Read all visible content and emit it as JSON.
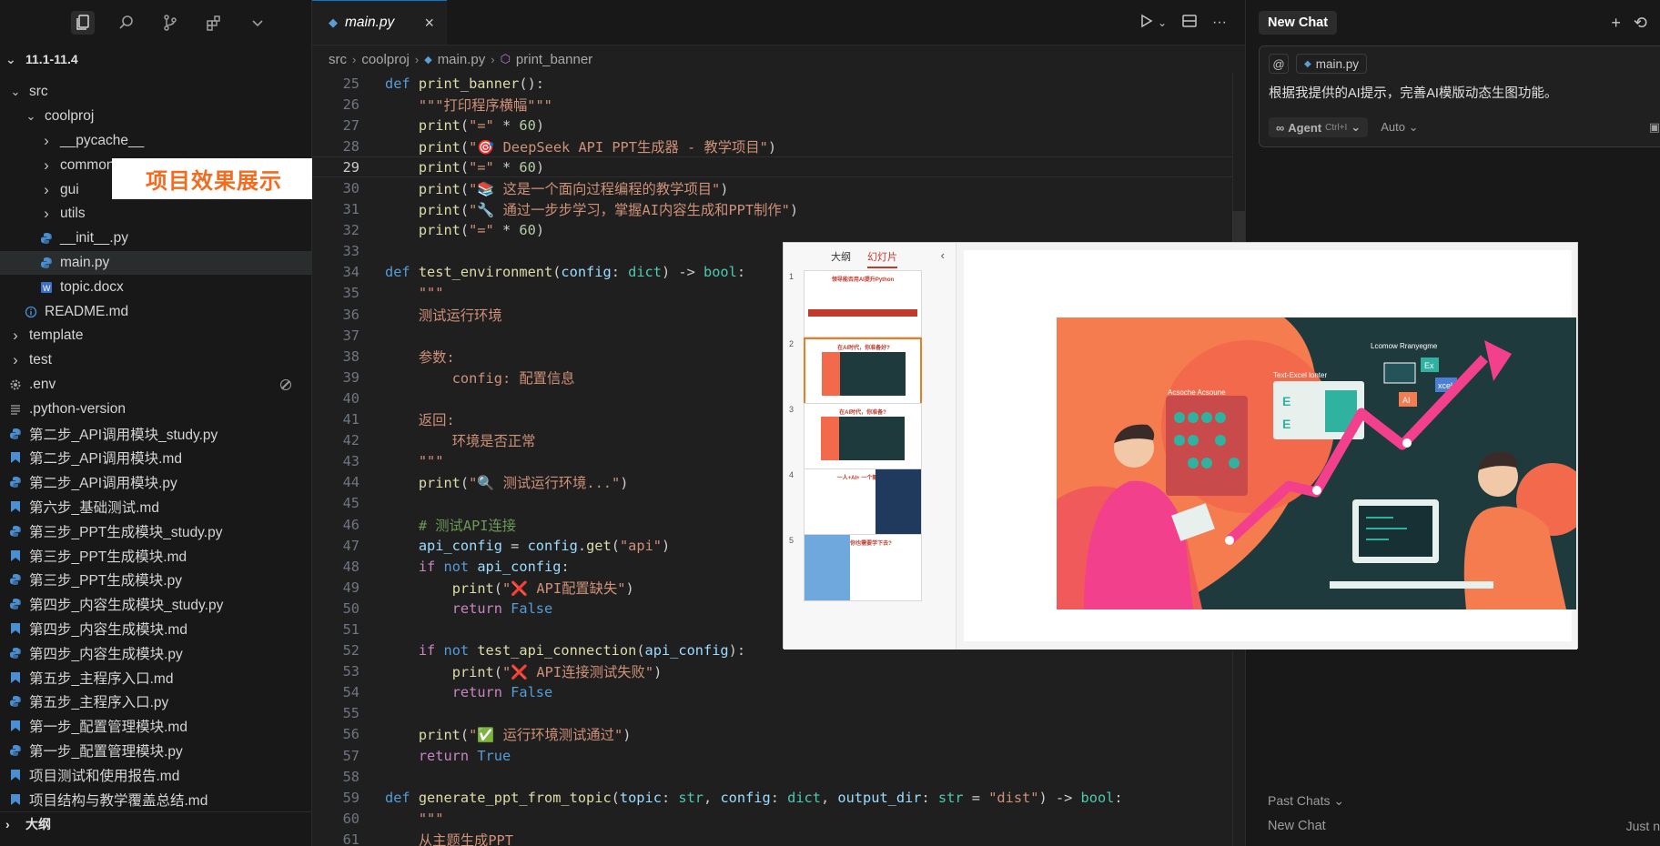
{
  "sidebar": {
    "workspace": "11.1-11.4",
    "overlay_label": "项目效果展示",
    "outline_label": "大纲",
    "items": [
      {
        "label": "src",
        "indent": 1,
        "type": "folder-open"
      },
      {
        "label": "coolproj",
        "indent": 2,
        "type": "folder-open"
      },
      {
        "label": "__pycache__",
        "indent": 3,
        "type": "folder"
      },
      {
        "label": "common",
        "indent": 3,
        "type": "folder"
      },
      {
        "label": "gui",
        "indent": 3,
        "type": "folder"
      },
      {
        "label": "utils",
        "indent": 3,
        "type": "folder"
      },
      {
        "label": "__init__.py",
        "indent": 3,
        "type": "py"
      },
      {
        "label": "main.py",
        "indent": 3,
        "type": "py",
        "selected": true
      },
      {
        "label": "topic.docx",
        "indent": 3,
        "type": "docx"
      },
      {
        "label": "README.md",
        "indent": 2,
        "type": "info"
      },
      {
        "label": "template",
        "indent": 1,
        "type": "folder"
      },
      {
        "label": "test",
        "indent": 1,
        "type": "folder"
      },
      {
        "label": ".env",
        "indent": 1,
        "type": "gear"
      },
      {
        "label": ".python-version",
        "indent": 1,
        "type": "lines"
      },
      {
        "label": "第二步_API调用模块_study.py",
        "indent": 1,
        "type": "py"
      },
      {
        "label": "第二步_API调用模块.md",
        "indent": 1,
        "type": "md"
      },
      {
        "label": "第二步_API调用模块.py",
        "indent": 1,
        "type": "py"
      },
      {
        "label": "第六步_基础测试.md",
        "indent": 1,
        "type": "md"
      },
      {
        "label": "第三步_PPT生成模块_study.py",
        "indent": 1,
        "type": "py"
      },
      {
        "label": "第三步_PPT生成模块.md",
        "indent": 1,
        "type": "md"
      },
      {
        "label": "第三步_PPT生成模块.py",
        "indent": 1,
        "type": "py"
      },
      {
        "label": "第四步_内容生成模块_study.py",
        "indent": 1,
        "type": "py"
      },
      {
        "label": "第四步_内容生成模块.md",
        "indent": 1,
        "type": "md"
      },
      {
        "label": "第四步_内容生成模块.py",
        "indent": 1,
        "type": "py"
      },
      {
        "label": "第五步_主程序入口.md",
        "indent": 1,
        "type": "md"
      },
      {
        "label": "第五步_主程序入口.py",
        "indent": 1,
        "type": "py"
      },
      {
        "label": "第一步_配置管理模块.md",
        "indent": 1,
        "type": "md"
      },
      {
        "label": "第一步_配置管理模块.py",
        "indent": 1,
        "type": "py"
      },
      {
        "label": "项目测试和使用报告.md",
        "indent": 1,
        "type": "md"
      },
      {
        "label": "项目结构与教学覆盖总结.md",
        "indent": 1,
        "type": "md"
      }
    ]
  },
  "editor": {
    "tab_label": "main.py",
    "breadcrumb": [
      "src",
      "coolproj",
      "main.py",
      "print_banner"
    ],
    "current_line": 29
  },
  "chat": {
    "tab_label": "New Chat",
    "context_file": "main.py",
    "message": "根据我提供的AI提示，完善AI模版动态生图功能。",
    "agent_label": "Agent",
    "agent_shortcut": "Ctrl+I",
    "model_label": "Auto",
    "past_label": "Past Chats",
    "past_item": "New Chat",
    "past_time": "Just n"
  },
  "ppt": {
    "tab_outline": "大纲",
    "tab_slides": "幻灯片",
    "art_labels": {
      "abacus": "Acsoche Acsoune",
      "sheet": "Text-Excel lonter",
      "top": "Lcomow Rranyegme",
      "ex": "Ex",
      "xcel": "xcel",
      "ai": "AI",
      "e": "E"
    },
    "thumb_titles": [
      "领导能否用AI提升Python",
      "在AI时代，你准备好?",
      "在AI时代，你准备?",
      "一人+AI+ 一个新世界",
      "为什么你也需要学下去?"
    ]
  },
  "colors": {
    "accent": "#0078d4",
    "overlay_text": "#f26b1f",
    "slide_bg": "#1f3a3d"
  }
}
